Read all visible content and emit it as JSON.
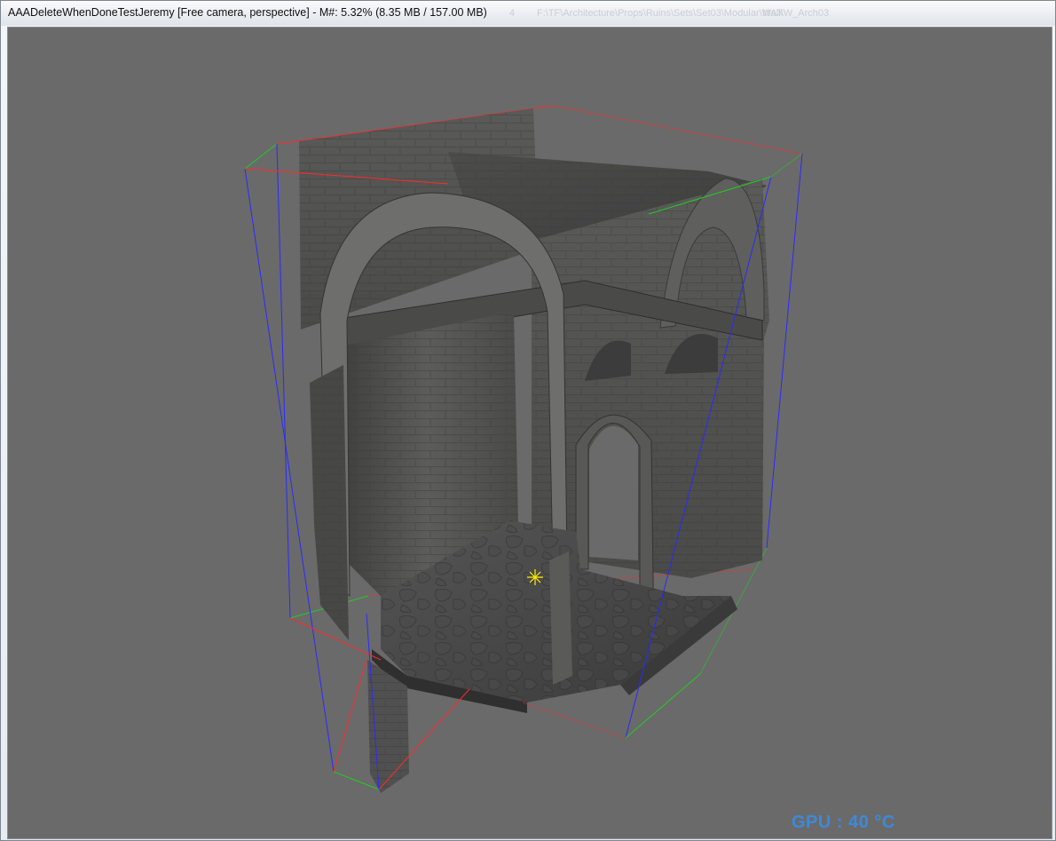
{
  "window": {
    "title": "AAADeleteWhenDoneTestJeremy [Free camera, perspective] - M#: 5.32% (8.35 MB / 157.00 MB)"
  },
  "background_ghost": [
    "4",
    "F:\\TF\\Architecture\\Props\\Ruins\\Sets\\Set03\\Modular\\Wall\\W_Arch03",
    "MAX"
  ],
  "viewport": {
    "camera": "Free camera, perspective",
    "gpu_label": "GPU : 40 °C"
  },
  "colors": {
    "viewport_bg": "#6a6a6a",
    "bbox_x_axis": "#ff2a2a",
    "bbox_y_axis": "#22cc22",
    "bbox_z_axis": "#2a2aff",
    "gpu_text": "#3e88dc",
    "pivot_marker": "#ffee00"
  },
  "icons": {
    "pivot": "pivot-star-icon"
  }
}
